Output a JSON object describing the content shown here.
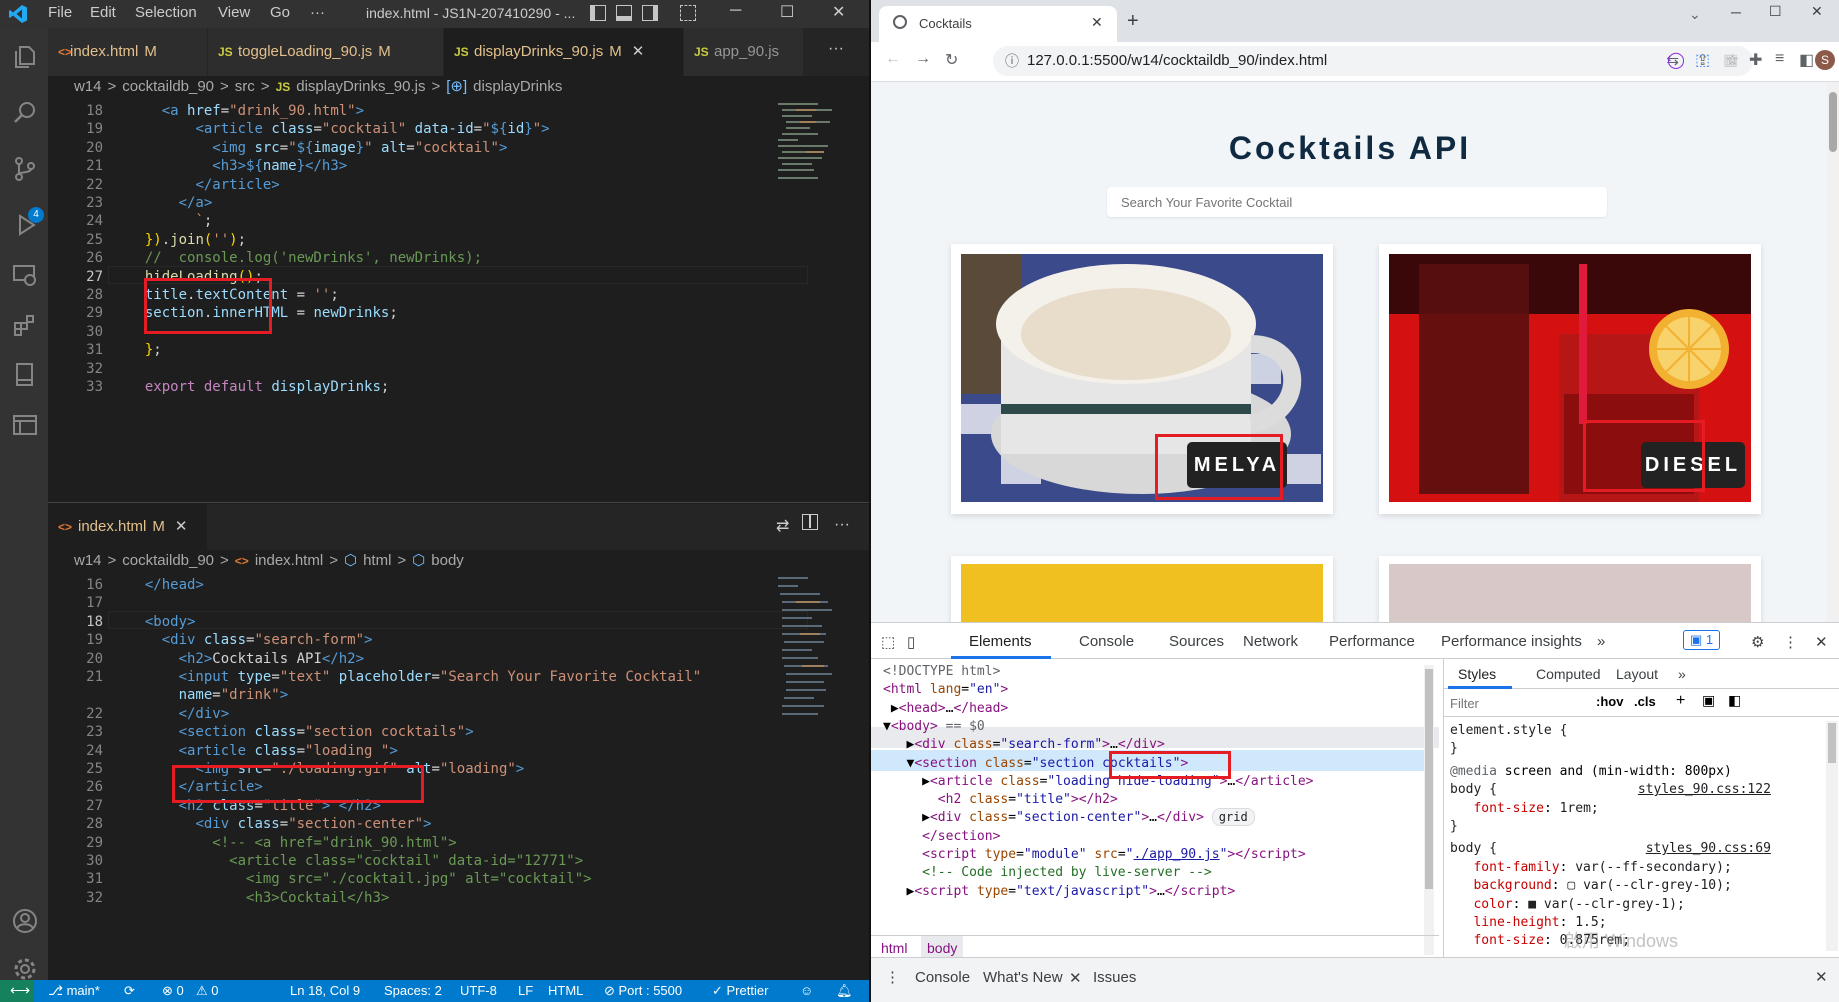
{
  "vscode": {
    "menu": [
      "File",
      "Edit",
      "Selection",
      "View",
      "Go",
      "···"
    ],
    "window_title": "index.html - JS1N-207410290 - ...",
    "top_tabs": [
      {
        "icon": "<>",
        "name": "index.html",
        "mod": "M"
      },
      {
        "icon": "JS",
        "name": "toggleLoading_90.js",
        "mod": "M"
      },
      {
        "icon": "JS",
        "name": "displayDrinks_90.js",
        "mod": "M"
      },
      {
        "icon": "JS",
        "name": "app_90.js",
        "mod": ""
      }
    ],
    "top_breadcrumb": [
      "w14",
      ">",
      "cocktaildb_90",
      ">",
      "src",
      ">",
      "JS",
      "displayDrinks_90.js",
      ">",
      "[⊕]",
      "displayDrinks"
    ],
    "top_lines": [
      {
        "n": "18",
        "html": "    <span class='c-tag'>&lt;a</span> <span class='c-attr'>href</span>=<span class='c-str'>\"drink_90.html\"</span><span class='c-tag'>&gt;</span>"
      },
      {
        "n": "19",
        "html": "        <span class='c-tag'>&lt;article</span> <span class='c-attr'>class</span>=<span class='c-str'>\"cocktail\"</span> <span class='c-attr'>data-id</span>=<span class='c-str'>\"</span><span class='c-kw2'>${</span><span class='c-var'>id</span><span class='c-kw2'>}</span><span class='c-str'>\"</span><span class='c-tag'>&gt;</span>"
      },
      {
        "n": "20",
        "html": "          <span class='c-tag'>&lt;img</span> <span class='c-attr'>src</span>=<span class='c-str'>\"</span><span class='c-kw2'>${</span><span class='c-var'>image</span><span class='c-kw2'>}</span><span class='c-str'>\"</span> <span class='c-attr'>alt</span>=<span class='c-str'>\"cocktail\"</span><span class='c-tag'>&gt;</span>"
      },
      {
        "n": "21",
        "html": "          <span class='c-tag'>&lt;h3&gt;</span><span class='c-kw2'>${</span><span class='c-var'>name</span><span class='c-kw2'>}</span><span class='c-tag'>&lt;/h3&gt;</span>"
      },
      {
        "n": "22",
        "html": "        <span class='c-tag'>&lt;/article&gt;</span>"
      },
      {
        "n": "23",
        "html": "      <span class='c-tag'>&lt;/a&gt;</span>"
      },
      {
        "n": "24",
        "html": "        <span class='c-str'>`</span>;"
      },
      {
        "n": "25",
        "html": "  <span class='c-br'>})</span>.<span class='c-fn'>join</span><span class='c-br'>(</span><span class='c-str'>''</span><span class='c-br'>)</span>;"
      },
      {
        "n": "26",
        "html": "  <span class='c-cmt'>//  console.log('newDrinks', newDrinks);</span>"
      },
      {
        "n": "27",
        "html": "  <span class='c-fn'>hideLoading</span><span class='c-br'>()</span>;"
      },
      {
        "n": "28",
        "html": "  <span class='c-var'>title</span>.<span class='c-var'>textContent</span> = <span class='c-str'>''</span>;"
      },
      {
        "n": "29",
        "html": "  <span class='c-var'>section</span>.<span class='c-var'>innerHTML</span> = <span class='c-var'>newDrinks</span>;"
      },
      {
        "n": "30",
        "html": ""
      },
      {
        "n": "31",
        "html": "  <span class='c-br'>}</span>;"
      },
      {
        "n": "32",
        "html": ""
      },
      {
        "n": "33",
        "html": "  <span class='c-kw'>export</span> <span class='c-kw'>default</span> <span class='c-var'>displayDrinks</span>;"
      }
    ],
    "bottom_tab": {
      "icon": "<>",
      "name": "index.html",
      "mod": "M"
    },
    "bottom_breadcrumb": [
      "w14",
      ">",
      "cocktaildb_90",
      ">",
      "<>",
      "index.html",
      ">",
      "html",
      ">",
      "body"
    ],
    "bottom_lines": [
      {
        "n": "16",
        "html": "  <span class='c-tag'>&lt;/head&gt;</span>"
      },
      {
        "n": "17",
        "html": ""
      },
      {
        "n": "18",
        "html": "  <span class='c-tag'>&lt;body&gt;</span>"
      },
      {
        "n": "19",
        "html": "    <span class='c-tag'>&lt;div</span> <span class='c-attr'>class</span>=<span class='c-str'>\"search-form\"</span><span class='c-tag'>&gt;</span>"
      },
      {
        "n": "20",
        "html": "      <span class='c-tag'>&lt;h2&gt;</span>Cocktails API<span class='c-tag'>&lt;/h2&gt;</span>"
      },
      {
        "n": "21",
        "html": "      <span class='c-tag'>&lt;input</span> <span class='c-attr'>type</span>=<span class='c-str'>\"text\"</span> <span class='c-attr'>placeholder</span>=<span class='c-str'>\"Search Your Favorite Cocktail\"</span>"
      },
      {
        "n": "",
        "html": "      <span class='c-attr'>name</span>=<span class='c-str'>\"drink\"</span><span class='c-tag'>&gt;</span>"
      },
      {
        "n": "22",
        "html": "      <span class='c-tag'>&lt;/div&gt;</span>"
      },
      {
        "n": "23",
        "html": "      <span class='c-tag'>&lt;section</span> <span class='c-attr'>class</span>=<span class='c-str'>\"section cocktails\"</span><span class='c-tag'>&gt;</span>"
      },
      {
        "n": "24",
        "html": "      <span class='c-tag'>&lt;article</span> <span class='c-attr'>class</span>=<span class='c-str'>\"loading \"</span><span class='c-tag'>&gt;</span>"
      },
      {
        "n": "25",
        "html": "        <span class='c-tag'>&lt;img</span> <span class='c-attr'>src</span>=<span class='c-str'>\"./loading.gif\"</span> <span class='c-attr'>alt</span>=<span class='c-str'>\"loading\"</span><span class='c-tag'>&gt;</span>"
      },
      {
        "n": "26",
        "html": "      <span class='c-tag'>&lt;/article&gt;</span>"
      },
      {
        "n": "27",
        "html": "      <span class='c-tag'>&lt;h2</span> <span class='c-attr'>class</span>=<span class='c-str'>\"title\"</span><span class='c-tag'>&gt;</span> <span class='c-tag'>&lt;/h2&gt;</span>"
      },
      {
        "n": "28",
        "html": "        <span class='c-tag'>&lt;div</span> <span class='c-attr'>class</span>=<span class='c-str'>\"section-center\"</span><span class='c-tag'>&gt;</span>"
      },
      {
        "n": "29",
        "html": "          <span class='c-cmt'>&lt;!-- &lt;a href=\"drink_90.html\"&gt;</span>"
      },
      {
        "n": "30",
        "html": "            <span class='c-cmt'>&lt;article class=\"cocktail\" data-id=\"12771\"&gt;</span>"
      },
      {
        "n": "31",
        "html": "              <span class='c-cmt'>&lt;img src=\"./cocktail.jpg\" alt=\"cocktail\"&gt;</span>"
      },
      {
        "n": "32",
        "html": "              <span class='c-cmt'>&lt;h3&gt;Cocktail&lt;/h3&gt;</span>"
      }
    ],
    "status": {
      "branch": "main*",
      "errors": "⊗ 0",
      "warnings": "⚠ 0",
      "position": "Ln 18, Col 9",
      "spaces": "Spaces: 2",
      "encoding": "UTF-8",
      "eol": "LF",
      "language": "HTML",
      "port": "Port : 5500",
      "prettier": "Prettier"
    }
  },
  "chrome": {
    "tab_title": "Cocktails",
    "url": "127.0.0.1:5500/w14/cocktaildb_90/index.html",
    "profile_initial": "S",
    "page": {
      "title": "Cocktails API",
      "search_placeholder": "Search Your Favorite Cocktail",
      "cards": [
        {
          "name": "MELYA"
        },
        {
          "name": "DIESEL"
        }
      ]
    },
    "devtools": {
      "tabs": [
        "Elements",
        "Console",
        "Sources",
        "Network",
        "Performance",
        "Performance insights",
        "»"
      ],
      "issues_count": "1",
      "dom_lines": [
        {
          "html": "<span class='d-doc'>&lt;!DOCTYPE html&gt;</span>"
        },
        {
          "html": "<span class='d-tag'>&lt;html</span> <span class='d-attr'>lang</span>=<span class='d-val'>\"en\"</span><span class='d-tag'>&gt;</span>"
        },
        {
          "html": " ▶<span class='d-tag'>&lt;head&gt;</span>…<span class='d-tag'>&lt;/head&gt;</span>"
        },
        {
          "html": "▼<span class='d-tag'>&lt;body&gt;</span> <span class='d-doc'>== $0</span>"
        },
        {
          "html": "   ▶<span class='d-tag'>&lt;div</span> <span class='d-attr'>class</span>=<span class='d-val'>\"search-form\"</span><span class='d-tag'>&gt;</span>…<span class='d-tag'>&lt;/div&gt;</span>"
        },
        {
          "html": "   ▼<span class='d-tag'>&lt;section</span> <span class='d-attr'>class</span>=<span class='d-val'>\"section cocktails\"</span><span class='d-tag'>&gt;</span>"
        },
        {
          "html": "     ▶<span class='d-tag'>&lt;article</span> <span class='d-attr'>class</span>=<span class='d-val'>\"loading hide-loading\"</span><span class='d-tag'>&gt;</span>…<span class='d-tag'>&lt;/article&gt;</span>"
        },
        {
          "html": "       <span class='d-tag'>&lt;h2</span> <span class='d-attr'>class</span>=<span class='d-val'>\"title\"</span><span class='d-tag'>&gt;&lt;/h2&gt;</span>"
        },
        {
          "html": "     ▶<span class='d-tag'>&lt;div</span> <span class='d-attr'>class</span>=<span class='d-val'>\"section-center\"</span><span class='d-tag'>&gt;</span>…<span class='d-tag'>&lt;/div&gt;</span> <span class='grid-badge'>grid</span>"
        },
        {
          "html": "     <span class='d-tag'>&lt;/section&gt;</span>"
        },
        {
          "html": "     <span class='d-tag'>&lt;script</span> <span class='d-attr'>type</span>=<span class='d-val'>\"module\"</span> <span class='d-attr'>src</span>=<span class='d-val'>\"<u>./app_90.js</u>\"</span><span class='d-tag'>&gt;&lt;/script&gt;</span>"
        },
        {
          "html": "     <span class='d-cmt'>&lt;!-- Code injected by live-server --&gt;</span>"
        },
        {
          "html": "   ▶<span class='d-tag'>&lt;script</span> <span class='d-attr'>type</span>=<span class='d-val'>\"text/javascript\"</span><span class='d-tag'>&gt;</span>…<span class='d-tag'>&lt;/script&gt;</span>"
        }
      ],
      "crumbs": [
        "html",
        "body"
      ],
      "style_tabs": [
        "Styles",
        "Computed",
        "Layout",
        "»"
      ],
      "filter_placeholder": "Filter",
      "hov": ":hov",
      "cls": ".cls",
      "style_lines": [
        {
          "html": "<span class='s-sel'>element.style {</span>"
        },
        {
          "html": "<span class='s-sel'>}</span>"
        },
        {
          "html": "<span class='s-media'>@media</span> screen and (min-width: 800px)"
        },
        {
          "html": "<span class='s-sel'>body {</span>                  <span class='s-link'>styles_90.css:122</span>"
        },
        {
          "html": "   <span class='s-prop'>font-size</span>: <span class='s-val'>1rem;</span>"
        },
        {
          "html": "<span class='s-sel'>}</span>"
        },
        {
          "html": "<span class='s-sel'>body {</span>                   <span class='s-link'>styles_90.css:69</span>"
        },
        {
          "html": "   <span class='s-prop'>font-family</span>: <span class='s-val'>var(--ff-secondary);</span>"
        },
        {
          "html": "   <span class='s-prop'>background</span>: <span class='s-val'>▢ var(--clr-grey-10);</span>"
        },
        {
          "html": "   <span class='s-prop'>color</span>: <span class='s-val'>■ var(--clr-grey-1);</span>"
        },
        {
          "html": "   <span class='s-prop'>line-height</span>: <span class='s-val'>1.5;</span>"
        },
        {
          "html": "   <span class='s-prop'>font-size</span>: <span class='s-val'>0.875rem;</span>"
        }
      ],
      "drawer_tabs": [
        "Console",
        "What's New",
        "Issues"
      ]
    }
  },
  "watermark": "啟用 Windows"
}
